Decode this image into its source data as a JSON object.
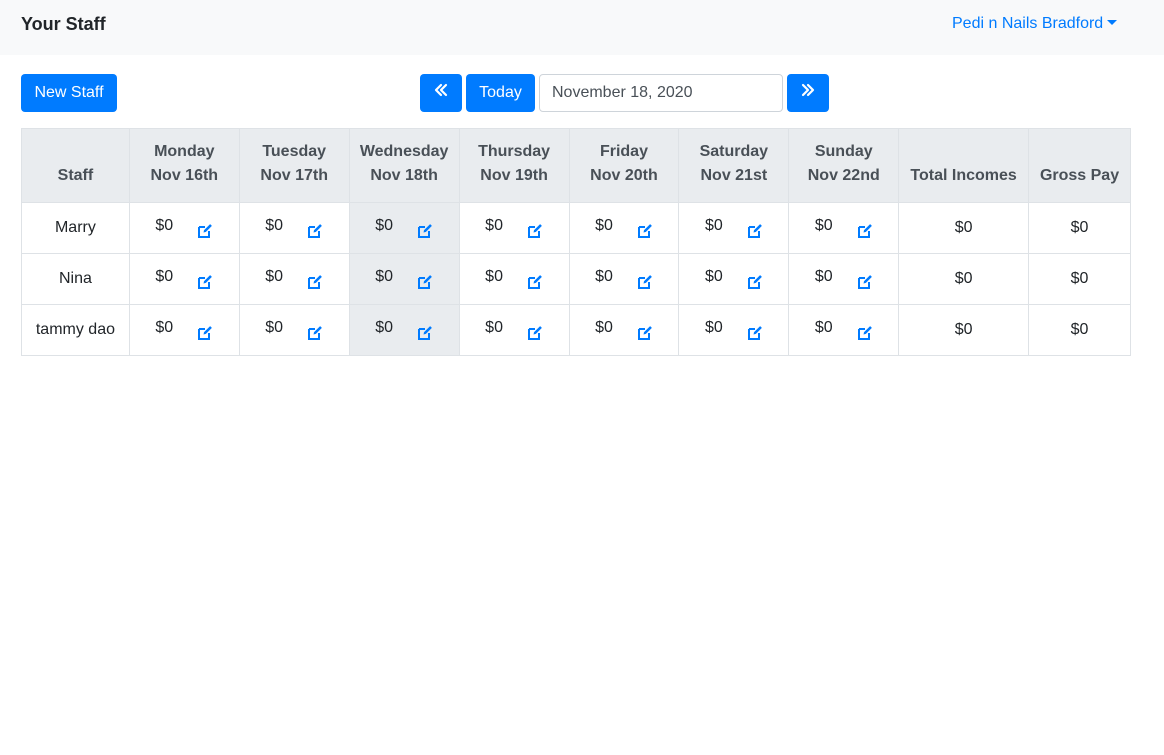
{
  "header": {
    "title": "Your Staff",
    "store_name": "Pedi n Nails Bradford"
  },
  "toolbar": {
    "new_staff_label": "New Staff",
    "today_label": "Today",
    "date_value": "November 18, 2020",
    "prev_icon": "double-chevron-left-icon",
    "next_icon": "double-chevron-right-icon"
  },
  "table": {
    "staff_header": "Staff",
    "total_header": "Total Incomes",
    "gross_header": "Gross Pay",
    "days": [
      {
        "day": "Monday",
        "date": "Nov 16th"
      },
      {
        "day": "Tuesday",
        "date": "Nov 17th"
      },
      {
        "day": "Wednesday",
        "date": "Nov 18th"
      },
      {
        "day": "Thursday",
        "date": "Nov 19th"
      },
      {
        "day": "Friday",
        "date": "Nov 20th"
      },
      {
        "day": "Saturday",
        "date": "Nov 21st"
      },
      {
        "day": "Sunday",
        "date": "Nov 22nd"
      }
    ],
    "rows": [
      {
        "name": "Marry",
        "amounts": [
          "$0",
          "$0",
          "$0",
          "$0",
          "$0",
          "$0",
          "$0"
        ],
        "total": "$0",
        "gross": "$0"
      },
      {
        "name": "Nina",
        "amounts": [
          "$0",
          "$0",
          "$0",
          "$0",
          "$0",
          "$0",
          "$0"
        ],
        "total": "$0",
        "gross": "$0"
      },
      {
        "name": "tammy dao",
        "amounts": [
          "$0",
          "$0",
          "$0",
          "$0",
          "$0",
          "$0",
          "$0"
        ],
        "total": "$0",
        "gross": "$0"
      }
    ]
  },
  "colors": {
    "accent": "#007bff",
    "header_bg": "#e9ecef",
    "navbar_bg": "#f8f9fa"
  }
}
